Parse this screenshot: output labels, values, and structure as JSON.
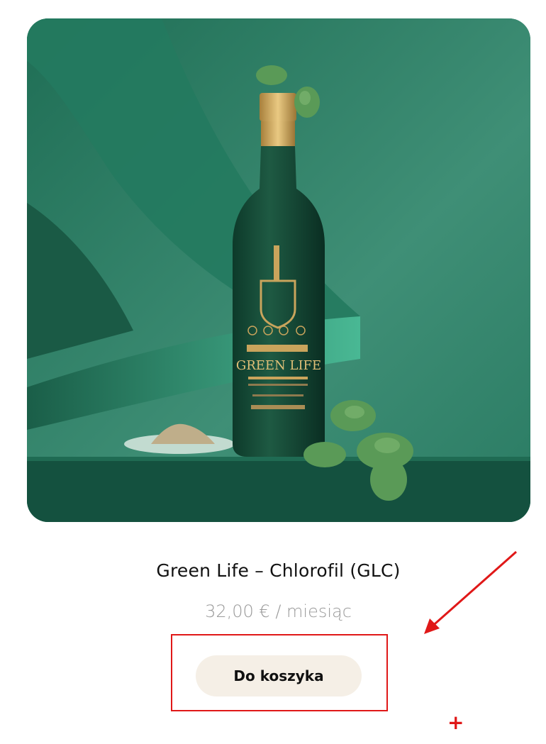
{
  "product": {
    "image_label": "GREEN LIFE",
    "title": "Green Life – Chlorofil (GLC)",
    "price": "32,00 € / miesiąc",
    "add_to_cart_label": "Do koszyka"
  },
  "annotation": {
    "plus": "+"
  },
  "colors": {
    "accent_red": "#e01818",
    "button_bg": "#f5efe6",
    "image_green": "#2f7d66"
  }
}
